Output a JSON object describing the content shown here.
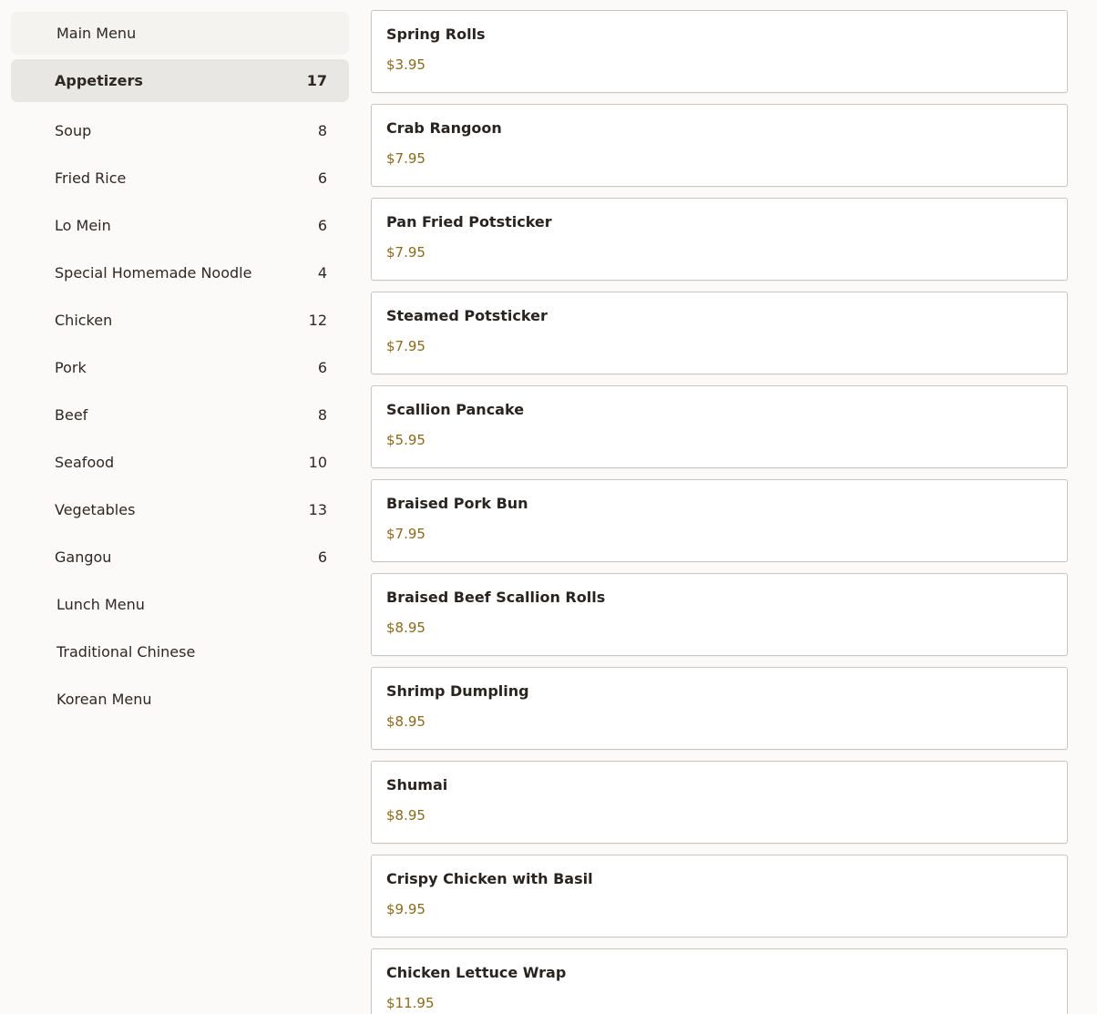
{
  "sidebar": {
    "main_menu": "Main Menu",
    "categories": [
      {
        "label": "Appetizers",
        "count": "17",
        "active": true
      },
      {
        "label": "Soup",
        "count": "8"
      },
      {
        "label": "Fried Rice",
        "count": "6"
      },
      {
        "label": "Lo Mein",
        "count": "6"
      },
      {
        "label": "Special Homemade Noodle",
        "count": "4"
      },
      {
        "label": "Chicken",
        "count": "12"
      },
      {
        "label": "Pork",
        "count": "6"
      },
      {
        "label": "Beef",
        "count": "8"
      },
      {
        "label": "Seafood",
        "count": "10"
      },
      {
        "label": "Vegetables",
        "count": "13"
      },
      {
        "label": "Gangou",
        "count": "6"
      }
    ],
    "other_menus": [
      "Lunch Menu",
      "Traditional Chinese",
      "Korean Menu"
    ]
  },
  "items": [
    {
      "name": "Spring Rolls",
      "price": "$3.95"
    },
    {
      "name": "Crab Rangoon",
      "price": "$7.95"
    },
    {
      "name": "Pan Fried Potsticker",
      "price": "$7.95"
    },
    {
      "name": "Steamed Potsticker",
      "price": "$7.95"
    },
    {
      "name": "Scallion Pancake",
      "price": "$5.95"
    },
    {
      "name": "Braised Pork Bun",
      "price": "$7.95"
    },
    {
      "name": "Braised Beef Scallion Rolls",
      "price": "$8.95"
    },
    {
      "name": "Shrimp Dumpling",
      "price": "$8.95"
    },
    {
      "name": "Shumai",
      "price": "$8.95"
    },
    {
      "name": "Crispy Chicken with Basil",
      "price": "$9.95"
    },
    {
      "name": "Chicken Lettuce Wrap",
      "price": "$11.95"
    }
  ],
  "colors": {
    "price": "#8a6a1e",
    "active_bg": "#e8e7e3",
    "header_bg": "#f4f3f0"
  }
}
